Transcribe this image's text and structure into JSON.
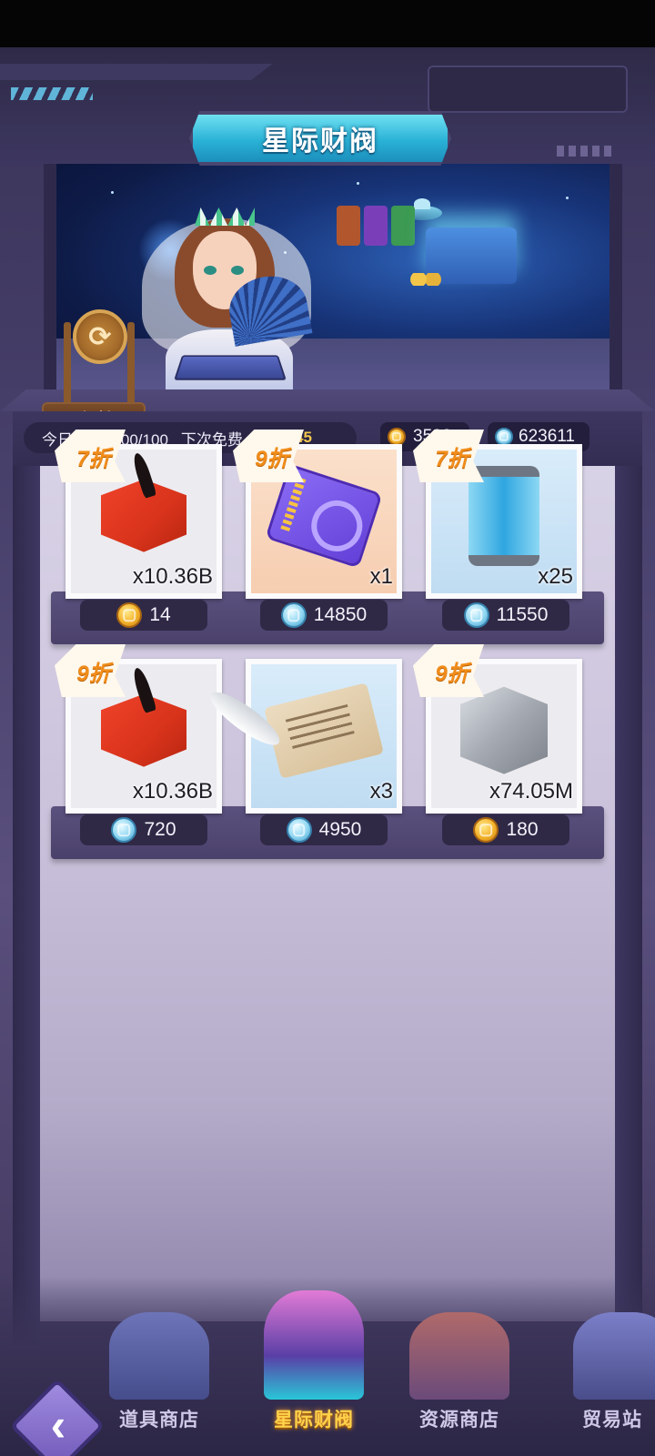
{
  "header": {
    "title": "星际财阀"
  },
  "refresh": {
    "label": "刷 新"
  },
  "info_bar": {
    "usage_label": "今日次数: 100/100",
    "next_free_label": "下次免费",
    "next_free_timer": "01:53:45",
    "gold_amount": "3580",
    "crystal_amount": "623611"
  },
  "items": [
    {
      "discount": "7折",
      "quantity": "x10.36B",
      "price": "14",
      "currency": "gold-coin-icon",
      "art": "red-cube"
    },
    {
      "discount": "9折",
      "quantity": "x1",
      "price": "14850",
      "currency": "crystal-coin-icon",
      "art": "dna-ticket"
    },
    {
      "discount": "7折",
      "quantity": "x25",
      "price": "11550",
      "currency": "crystal-coin-icon",
      "art": "canister"
    },
    {
      "discount": "9折",
      "quantity": "x10.36B",
      "price": "720",
      "currency": "crystal-coin-icon",
      "art": "red-cube"
    },
    {
      "discount": "",
      "quantity": "x3",
      "price": "4950",
      "currency": "crystal-coin-icon",
      "art": "scroll-quill"
    },
    {
      "discount": "9折",
      "quantity": "x74.05M",
      "price": "180",
      "currency": "gold-coin-icon",
      "art": "metal-cube"
    }
  ],
  "bottom_nav": {
    "tabs": [
      {
        "label": "道具商店",
        "active": false
      },
      {
        "label": "星际财阀",
        "active": true
      },
      {
        "label": "资源商店",
        "active": false
      },
      {
        "label": "贸易站",
        "active": false
      }
    ]
  },
  "colors": {
    "title_cyan": "#2ab2d6",
    "timer_yellow": "#f3c84f",
    "discount_orange": "#f08c1a",
    "active_tab": "#ffd24a"
  }
}
